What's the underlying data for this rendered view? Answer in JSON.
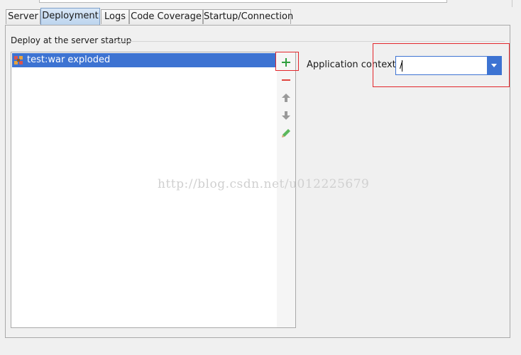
{
  "tabs": [
    {
      "label": "Server",
      "active": false
    },
    {
      "label": "Deployment",
      "active": true
    },
    {
      "label": "Logs",
      "active": false
    },
    {
      "label": "Code Coverage",
      "active": false
    },
    {
      "label": "Startup/Connection",
      "active": false
    }
  ],
  "deployment": {
    "group_label": "Deploy at the server startup",
    "artifacts": [
      {
        "label": "test:war exploded",
        "selected": true,
        "icon": "war-artifact-icon"
      }
    ],
    "toolbar": {
      "icons": [
        "add-icon",
        "remove-icon",
        "move-up-icon",
        "move-down-icon",
        "edit-icon"
      ]
    },
    "application_context": {
      "label": "Application context:",
      "value": "/"
    }
  },
  "watermark": "http://blog.csdn.net/u012225679",
  "colors": {
    "selection": "#3d73d2",
    "add_green": "#2e9f3e",
    "remove_red": "#e0443e",
    "annotation_red": "#e3262b"
  }
}
